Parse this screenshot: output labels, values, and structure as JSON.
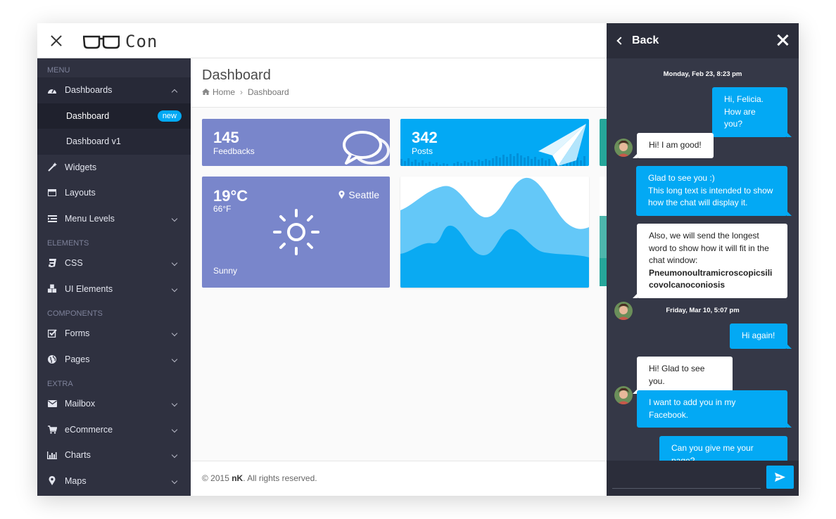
{
  "app": {
    "logo_text": "Con"
  },
  "sidebar": {
    "sections": [
      "MENU",
      "ELEMENTS",
      "COMPONENTS",
      "EXTRA"
    ],
    "dashboards": {
      "label": "Dashboards",
      "icon": "dashboard-icon"
    },
    "sub": [
      {
        "label": "Dashboard",
        "badge": "new"
      },
      {
        "label": "Dashboard v1"
      }
    ],
    "items": [
      {
        "label": "Widgets",
        "icon": "magic-wand-icon"
      },
      {
        "label": "Layouts",
        "icon": "window-icon"
      },
      {
        "label": "Menu Levels",
        "icon": "list-icon"
      },
      {
        "label": "CSS",
        "icon": "css3-icon"
      },
      {
        "label": "UI Elements",
        "icon": "cubes-icon"
      },
      {
        "label": "Forms",
        "icon": "checkbox-icon"
      },
      {
        "label": "Pages",
        "icon": "globe-icon"
      },
      {
        "label": "Mailbox",
        "icon": "envelope-icon"
      },
      {
        "label": "eCommerce",
        "icon": "cart-icon"
      },
      {
        "label": "Charts",
        "icon": "bar-chart-icon"
      },
      {
        "label": "Maps",
        "icon": "map-marker-icon"
      }
    ]
  },
  "main": {
    "title": "Dashboard",
    "breadcrumb": [
      "Home",
      "Dashboard"
    ],
    "cards": {
      "feedbacks": {
        "value": "145",
        "label": "Feedbacks"
      },
      "posts": {
        "value": "342",
        "label": "Posts"
      },
      "weather": {
        "temp_c": "19°C",
        "temp_f": "66°F",
        "city": "Seattle",
        "condition": "Sunny"
      }
    },
    "footer": {
      "prefix": "© 2015 ",
      "brand": "nK",
      "suffix": ". All rights reserved."
    }
  },
  "chat": {
    "back_label": "Back",
    "messages": [
      {
        "type": "date",
        "text": "Monday, Feb 23, 8:23 pm"
      },
      {
        "type": "out",
        "text": "Hi, Felicia.\nHow are you?"
      },
      {
        "type": "in",
        "text": "Hi! I am good!"
      },
      {
        "type": "out",
        "text": "Glad to see you :)\nThis long text is intended to show how the chat will display it."
      },
      {
        "type": "in",
        "text": "Also, we will send the longest word to show how it will fit in the chat window:",
        "bold": "Pneumonoultramicroscopicsilicovolcanoconiosis"
      },
      {
        "type": "date",
        "text": "Friday, Mar 10, 5:07 pm"
      },
      {
        "type": "out",
        "text": "Hi again!"
      },
      {
        "type": "in",
        "text": "Hi! Glad to see you."
      },
      {
        "type": "out",
        "text": "I want to add you in my Facebook."
      },
      {
        "type": "out",
        "text": "Can you give me your page?"
      }
    ],
    "input": {
      "value": "",
      "placeholder": ""
    }
  },
  "colors": {
    "accent": "#03a9f4",
    "indigo": "#7986cb",
    "teal": "#26a69a",
    "sidebar": "#2f3140",
    "chat_bg": "#353847"
  }
}
